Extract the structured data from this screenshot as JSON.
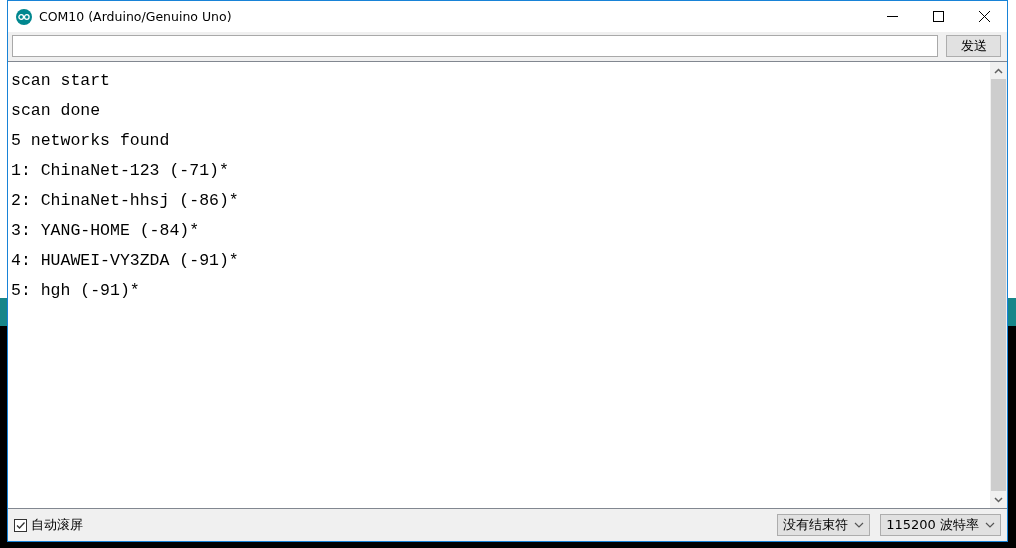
{
  "window": {
    "title": "COM10 (Arduino/Genuino Uno)"
  },
  "send_button": "发送",
  "output_lines": [
    "scan start",
    "scan done",
    "5 networks found",
    "1: ChinaNet-123 (-71)*",
    "2: ChinaNet-hhsj (-86)*",
    "3: YANG-HOME (-84)*",
    "4: HUAWEI-VY3ZDA (-91)*",
    "5: hgh (-91)*"
  ],
  "autoscroll": {
    "label": "自动滚屏",
    "checked": true
  },
  "line_ending": {
    "value": "没有结束符"
  },
  "baud_rate": {
    "value": "115200 波特率"
  }
}
